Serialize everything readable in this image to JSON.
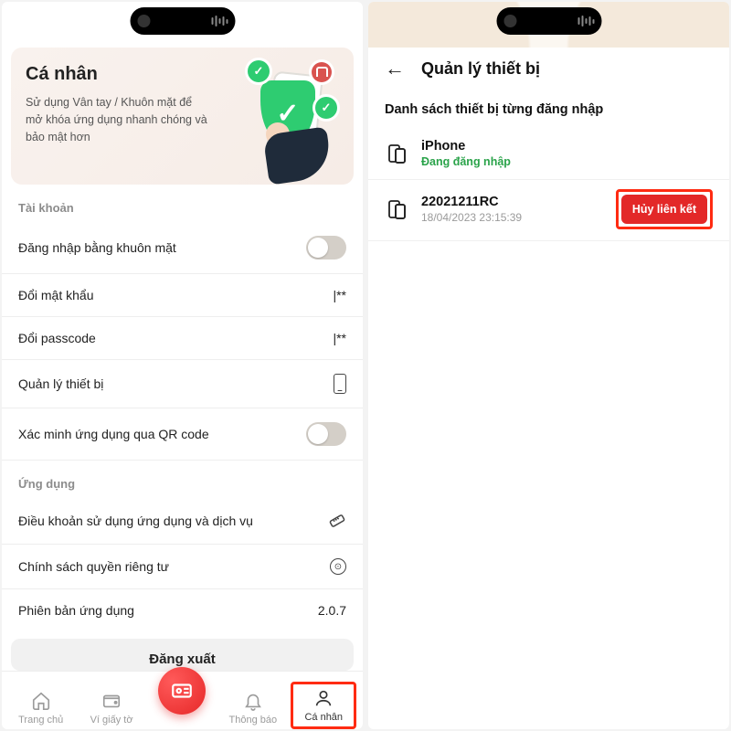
{
  "left": {
    "hero": {
      "title": "Cá nhân",
      "subtitle": "Sử dụng Vân tay / Khuôn mặt để mở khóa ứng dụng nhanh chóng và bảo mật hơn"
    },
    "section_account_label": "Tài khoản",
    "rows": {
      "face_login": "Đăng nhập bằng khuôn mặt",
      "change_password": "Đổi mật khẩu",
      "change_password_val": "|**",
      "change_passcode": "Đổi passcode",
      "change_passcode_val": "|**",
      "manage_devices": "Quản lý thiết bị",
      "verify_qr": "Xác minh ứng dụng qua QR code"
    },
    "section_app_label": "Ứng dụng",
    "app_rows": {
      "terms": "Điều khoản sử dụng ứng dụng và dịch vụ",
      "privacy": "Chính sách quyền riêng tư",
      "version_label": "Phiên bản ứng dụng",
      "version_value": "2.0.7"
    },
    "logout": "Đăng xuất",
    "tabs": {
      "home": "Trang chủ",
      "wallet": "Ví giấy tờ",
      "notify": "Thông báo",
      "profile": "Cá nhân"
    }
  },
  "right": {
    "title": "Quản lý thiết bị",
    "list_label": "Danh sách thiết bị từng đăng nhập",
    "devices": [
      {
        "name": "iPhone",
        "sub": "Đang đăng nhập",
        "sub_type": "green"
      },
      {
        "name": "22021211RC",
        "sub": "18/04/2023 23:15:39",
        "sub_type": "grey"
      }
    ],
    "unlink": "Hủy liên kết"
  }
}
